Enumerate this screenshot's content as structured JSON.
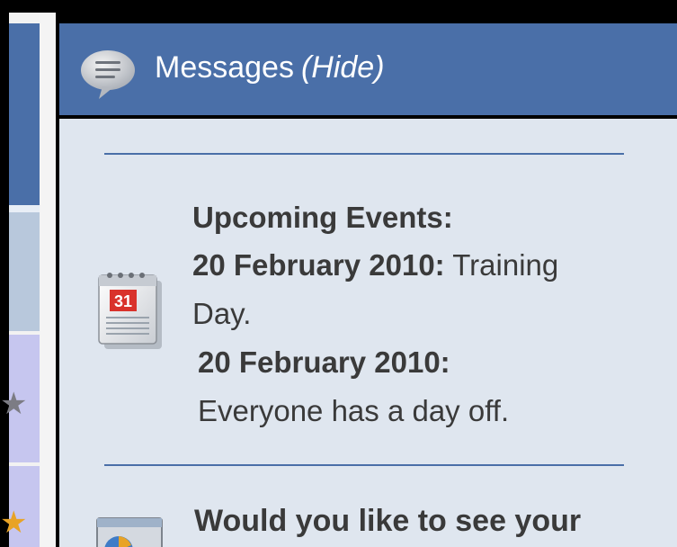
{
  "header": {
    "title": "Messages",
    "hide_link": "(Hide)"
  },
  "events": {
    "heading": "Upcoming Events:",
    "calendar_day": "31",
    "items": [
      {
        "date": "20 February 2010:",
        "text": "Training Day."
      },
      {
        "date": "20 February 2010:",
        "text": "Everyone has a day off."
      }
    ]
  },
  "promo": {
    "text": "Would you like to see your"
  },
  "icons": {
    "header": "chat-bubble-icon",
    "events": "calendar-icon",
    "promo": "report-icon",
    "sidebar": [
      "star-icon",
      "star-icon"
    ]
  },
  "colors": {
    "header_bg": "#4a6fa8",
    "body_bg": "#dfe6ef",
    "divider": "#4a6fa8",
    "text": "#3a3a3a",
    "calendar_red": "#d9322b",
    "star_gold": "#e8a326"
  }
}
